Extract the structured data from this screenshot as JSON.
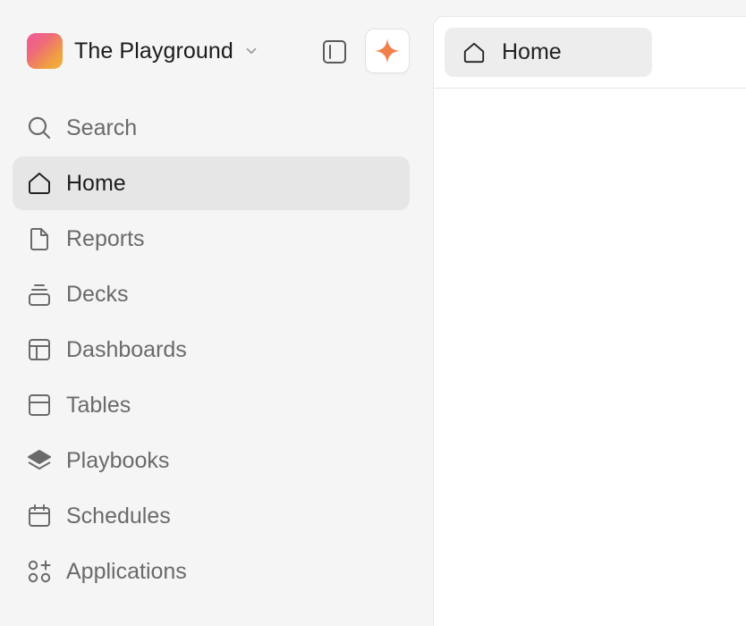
{
  "workspace": {
    "name": "The Playground",
    "logo_gradient": [
      "#f0589a",
      "#f2b43a"
    ]
  },
  "sidebar": {
    "items": [
      {
        "label": "Search",
        "icon": "search-icon",
        "active": false
      },
      {
        "label": "Home",
        "icon": "home-icon",
        "active": true
      },
      {
        "label": "Reports",
        "icon": "document-icon",
        "active": false
      },
      {
        "label": "Decks",
        "icon": "stack-icon",
        "active": false
      },
      {
        "label": "Dashboards",
        "icon": "dashboard-layout-icon",
        "active": false
      },
      {
        "label": "Tables",
        "icon": "table-icon",
        "active": false
      },
      {
        "label": "Playbooks",
        "icon": "layers-icon",
        "active": false
      },
      {
        "label": "Schedules",
        "icon": "calendar-icon",
        "active": false
      },
      {
        "label": "Applications",
        "icon": "apps-grid-icon",
        "active": false
      }
    ]
  },
  "tabs": [
    {
      "label": "Home",
      "icon": "home-icon"
    }
  ],
  "colors": {
    "sidebar_bg": "#f5f5f5",
    "active_item_bg": "#e6e6e6",
    "ai_accent": "#f07f4a",
    "muted_text": "#6a6a6a"
  }
}
